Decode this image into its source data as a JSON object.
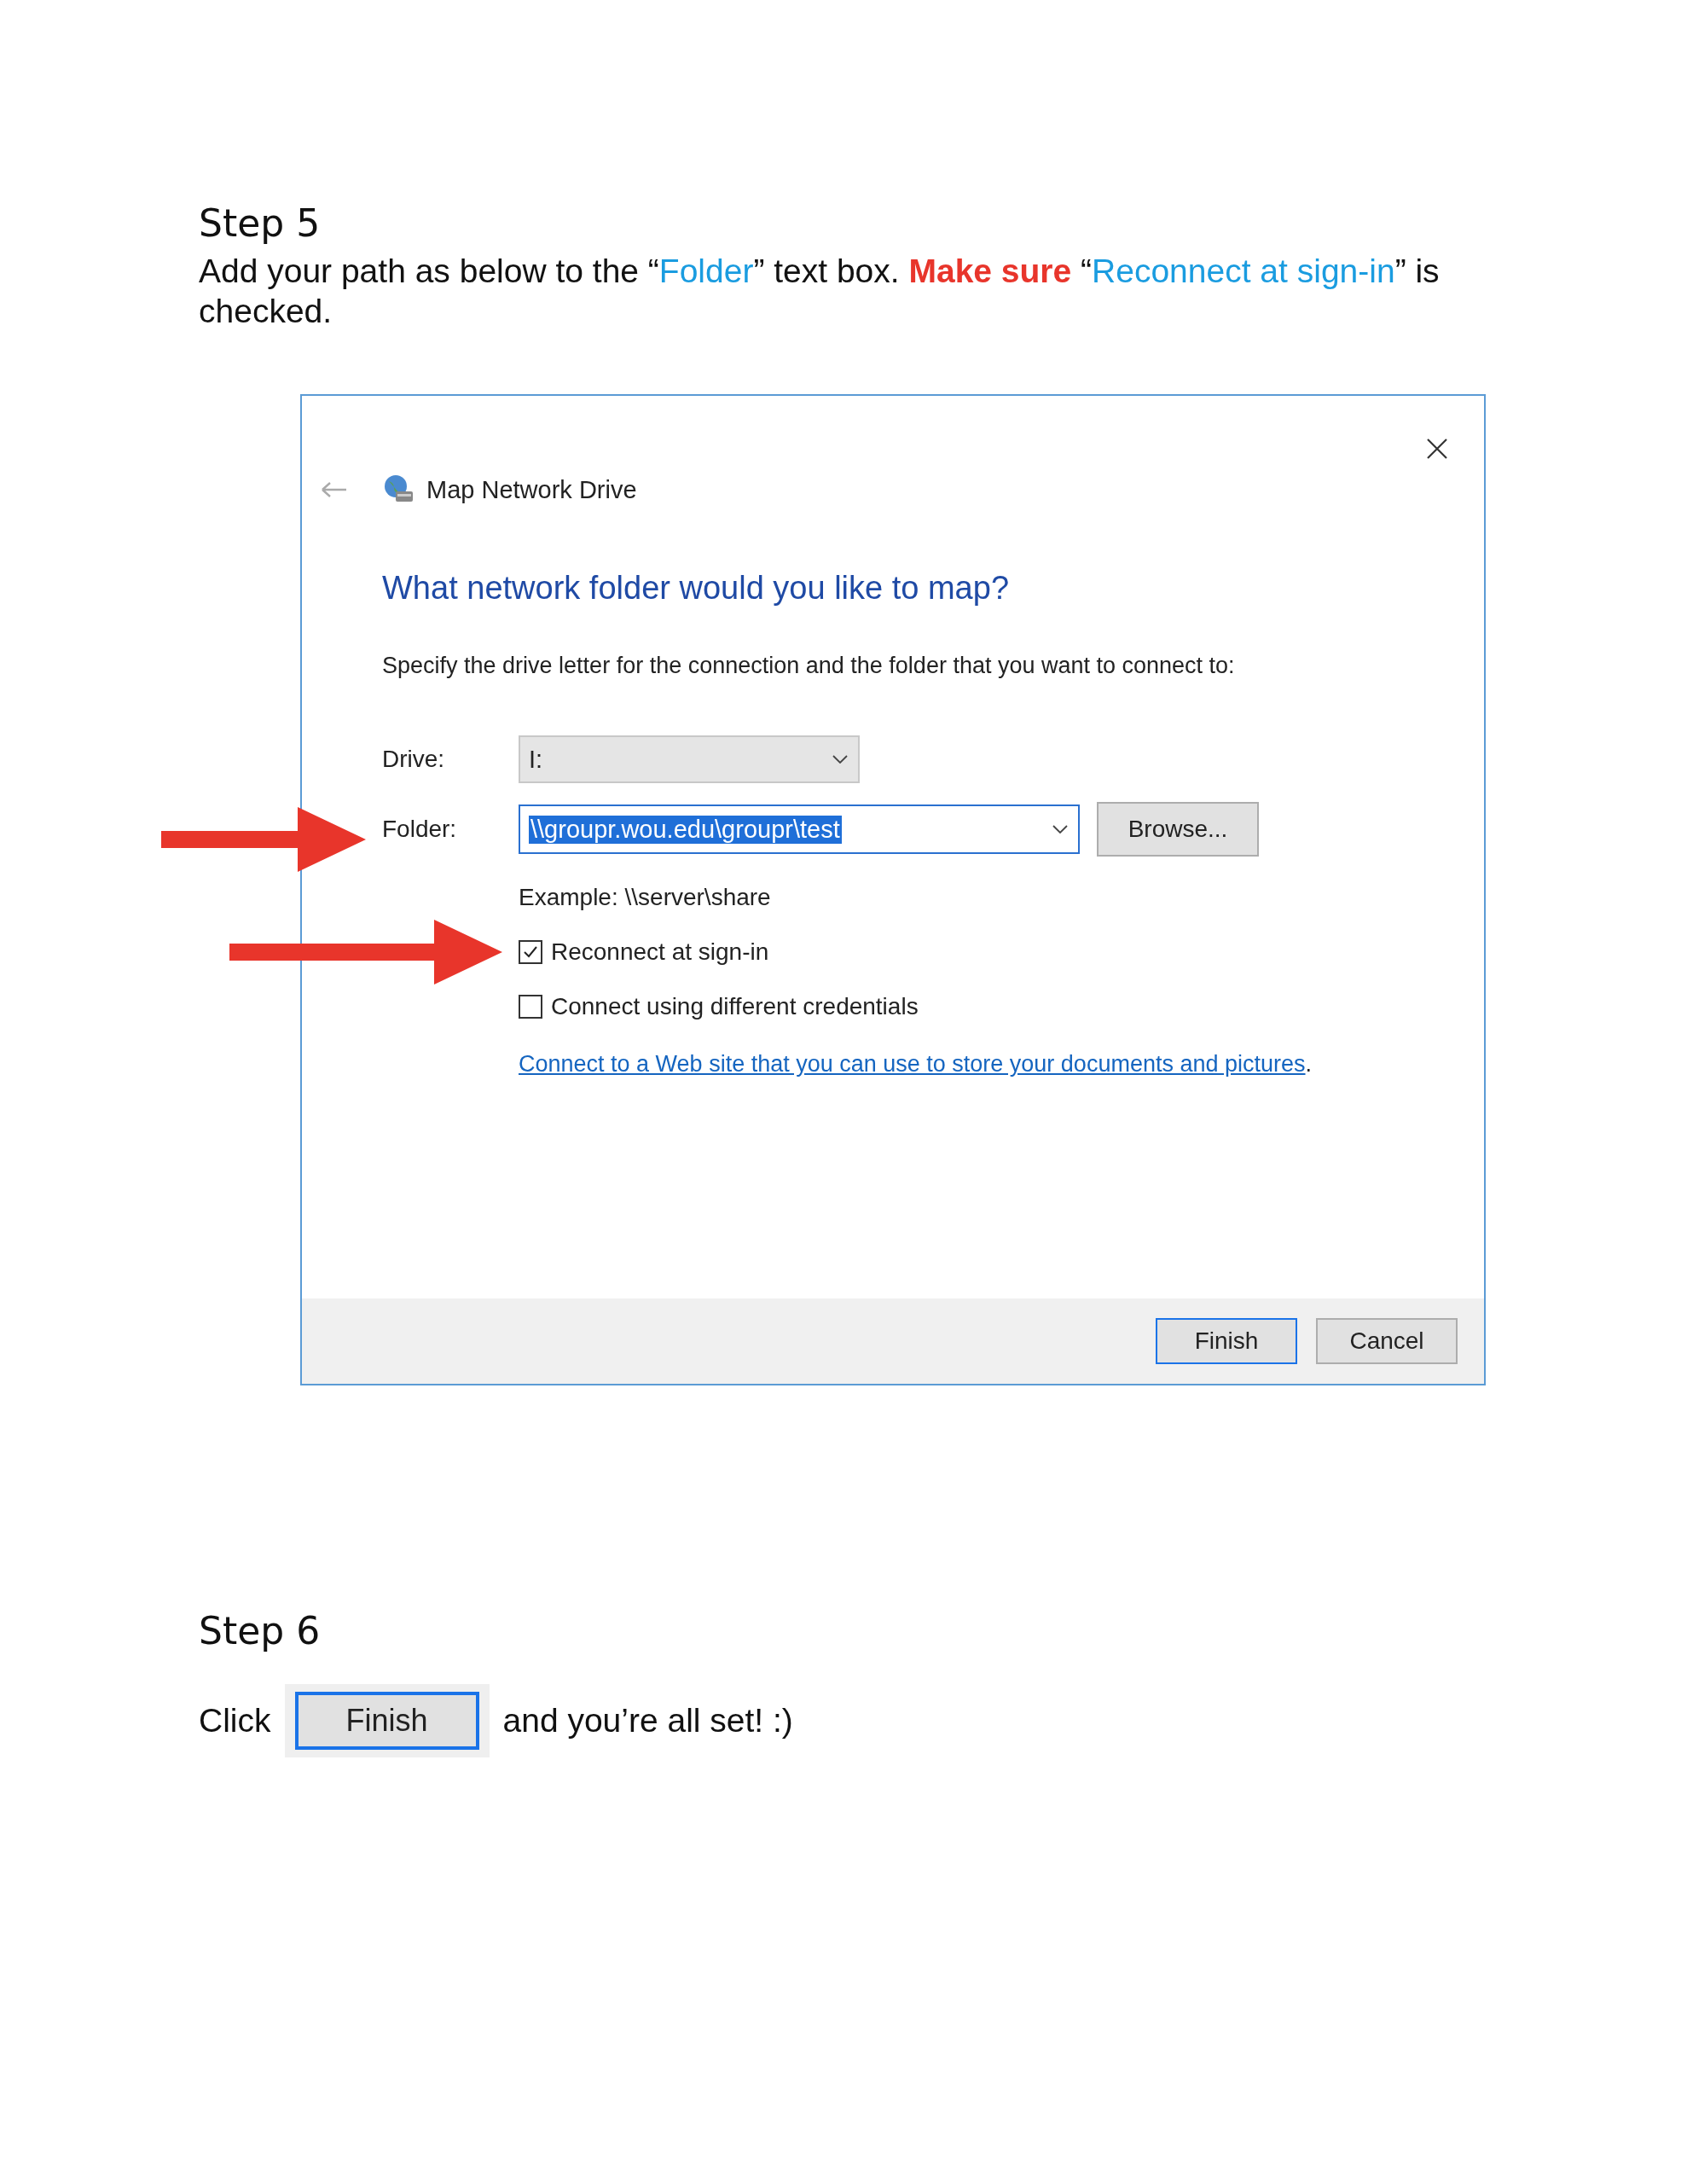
{
  "step5": {
    "heading": "Step 5",
    "instruction": [
      {
        "kind": "plain",
        "text": "Add your path as below to the “"
      },
      {
        "kind": "highlight",
        "text": "Folder"
      },
      {
        "kind": "plain",
        "text": "” text box. "
      },
      {
        "kind": "emphasis",
        "text": "Make sure"
      },
      {
        "kind": "plain",
        "text": " “"
      },
      {
        "kind": "highlight",
        "text": "Reconnect at sign-in"
      },
      {
        "kind": "plain",
        "text": "” is checked."
      }
    ]
  },
  "dialog": {
    "title": "Map Network Drive",
    "heading": "What network folder would you like to map?",
    "description": "Specify the drive letter for the connection and the folder that you want to connect to:",
    "drive": {
      "label": "Drive:",
      "value": "I:"
    },
    "folder": {
      "label": "Folder:",
      "value": "\\\\groupr.wou.edu\\groupr\\test",
      "value_selected": true
    },
    "browse_button": "Browse...",
    "example": "Example: \\\\server\\share",
    "checkboxes": [
      {
        "label": "Reconnect at sign-in",
        "checked": true
      },
      {
        "label": "Connect using different credentials",
        "checked": false
      }
    ],
    "link": {
      "text": "Connect to a Web site that you can use to store your documents and pictures",
      "after": "."
    },
    "buttons": [
      {
        "label": "Finish",
        "default": true
      },
      {
        "label": "Cancel",
        "default": false
      }
    ]
  },
  "step6": {
    "heading": "Step 6",
    "before": "Click",
    "button": "Finish",
    "after": "and you’re all set! :)"
  }
}
